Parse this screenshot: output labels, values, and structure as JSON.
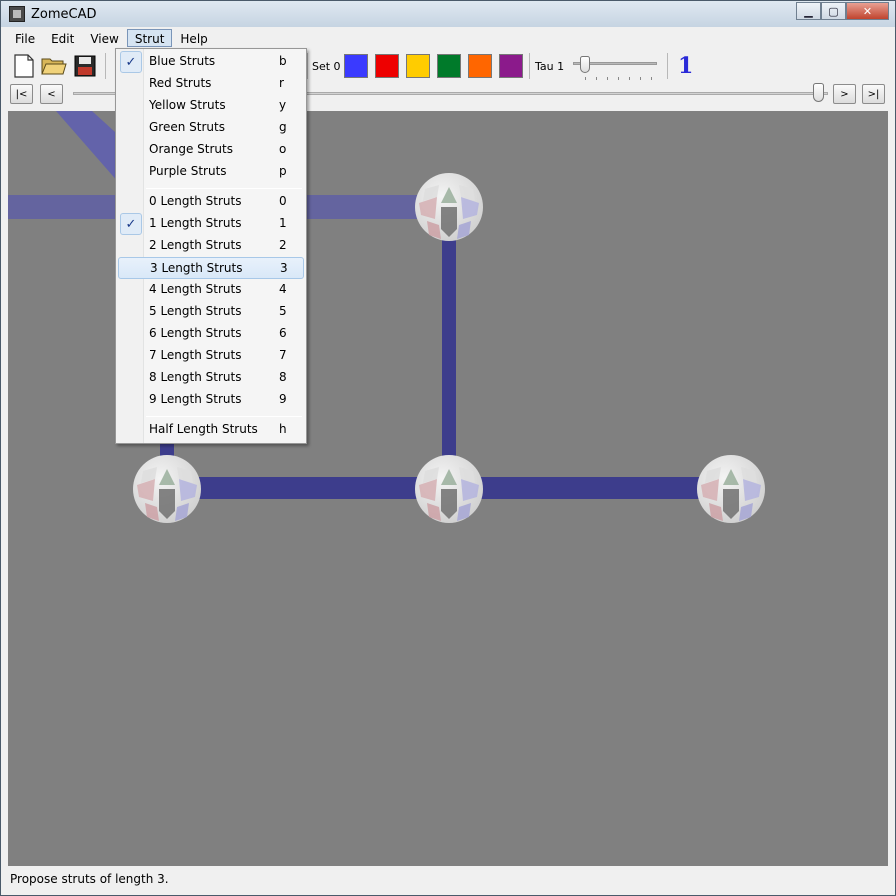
{
  "window": {
    "title": "ZomeCAD"
  },
  "menubar": {
    "items": [
      {
        "label": "File"
      },
      {
        "label": "Edit"
      },
      {
        "label": "View"
      },
      {
        "label": "Strut"
      },
      {
        "label": "Help"
      }
    ]
  },
  "toolbar": {
    "set_label": "Set 0",
    "colors": [
      "#3a3aff",
      "#ee0000",
      "#ffcc00",
      "#007a2a",
      "#ff6600",
      "#8b1a8b"
    ],
    "tau_label": "Tau 1",
    "tau_value": "1"
  },
  "scrub": {
    "first_label": "|<",
    "prev_label": "<",
    "next_label": ">",
    "last_label": ">|"
  },
  "strut_menu": {
    "items": [
      {
        "label": "Blue Struts",
        "key": "b",
        "checked": true
      },
      {
        "label": "Red Struts",
        "key": "r"
      },
      {
        "label": "Yellow Struts",
        "key": "y"
      },
      {
        "label": "Green Struts",
        "key": "g"
      },
      {
        "label": "Orange Struts",
        "key": "o"
      },
      {
        "label": "Purple Struts",
        "key": "p"
      },
      {
        "label": "0 Length Struts",
        "key": "0"
      },
      {
        "label": "1 Length Struts",
        "key": "1",
        "checked": true
      },
      {
        "label": "2 Length Struts",
        "key": "2"
      },
      {
        "label": "3 Length Struts",
        "key": "3",
        "highlighted": true
      },
      {
        "label": "4 Length Struts",
        "key": "4"
      },
      {
        "label": "5 Length Struts",
        "key": "5"
      },
      {
        "label": "6 Length Struts",
        "key": "6"
      },
      {
        "label": "7 Length Struts",
        "key": "7"
      },
      {
        "label": "8 Length Struts",
        "key": "8"
      },
      {
        "label": "9 Length Struts",
        "key": "9"
      },
      {
        "label": "Half Length Struts",
        "key": "h"
      }
    ],
    "check_glyph": "✓"
  },
  "status": {
    "text": "Propose struts of length 3."
  },
  "scene": {
    "strut_color": "#3d3d8c",
    "ball_color": "#e6e6e6"
  }
}
